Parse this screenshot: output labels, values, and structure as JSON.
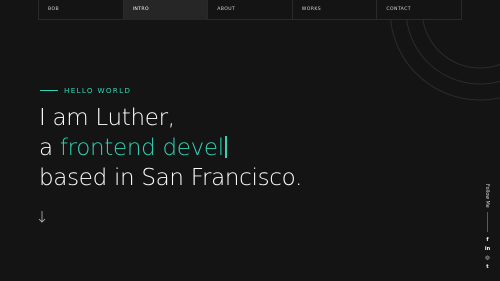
{
  "nav": {
    "items": [
      {
        "label": "BOB",
        "active": false
      },
      {
        "label": "INTRO",
        "active": true
      },
      {
        "label": "ABOUT",
        "active": false
      },
      {
        "label": "WORKS",
        "active": false
      },
      {
        "label": "CONTACT",
        "active": false
      }
    ]
  },
  "hero": {
    "eyebrow": "HELLO WORLD",
    "line1": "I am Luther,",
    "line2_prefix": "a ",
    "line2_typed": "frontend devel",
    "line3": "based in San Francisco."
  },
  "sidebar": {
    "follow_label": "Follow Me",
    "socials": [
      {
        "icon": "facebook-icon",
        "glyph": "f"
      },
      {
        "icon": "linkedin-icon",
        "glyph": "in"
      },
      {
        "icon": "dribbble-icon",
        "glyph": "◎"
      },
      {
        "icon": "twitter-icon",
        "glyph": "t"
      }
    ]
  },
  "colors": {
    "background": "#141414",
    "accent": "#2fd4b5",
    "text": "#ffffff",
    "nav_active": "#262626"
  }
}
